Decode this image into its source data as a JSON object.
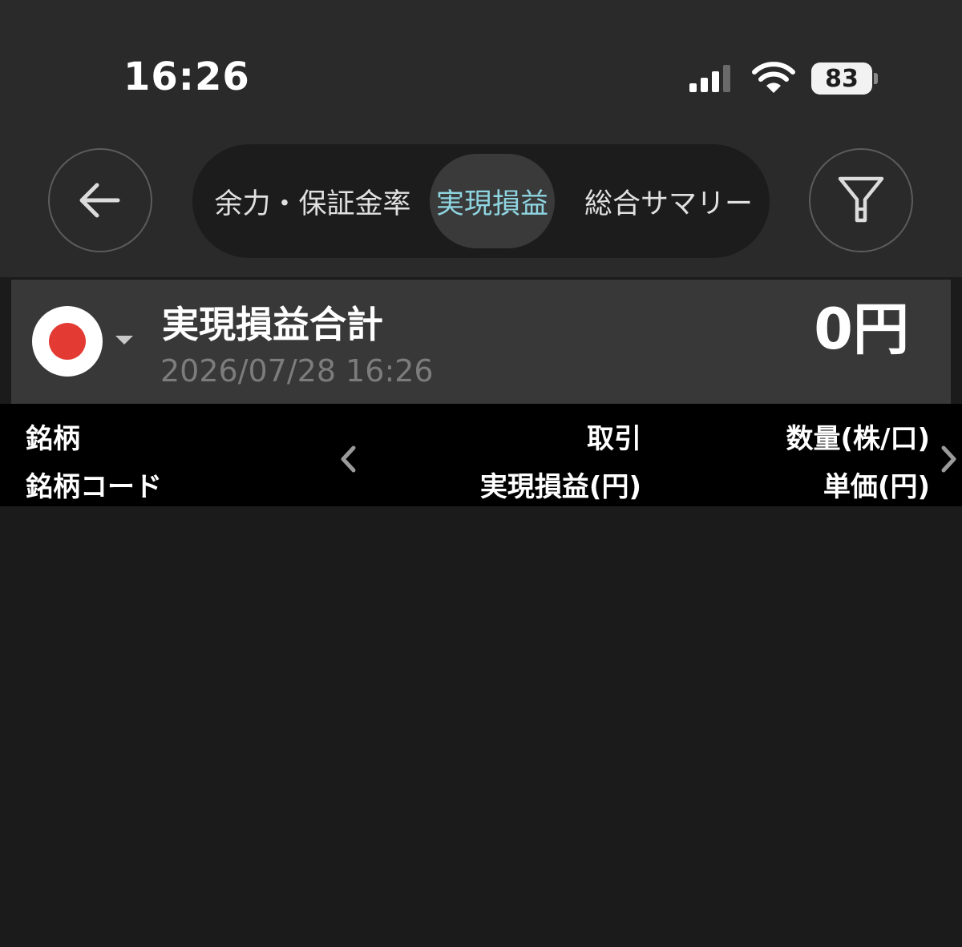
{
  "status_bar": {
    "time": "16:26",
    "battery": "83"
  },
  "nav": {
    "back_icon": "arrow-left-icon",
    "filter_icon": "filter-icon",
    "tabs": [
      {
        "label": "余力・保証金率",
        "active": false
      },
      {
        "label": "実現損益",
        "active": true
      },
      {
        "label": "総合サマリー",
        "active": false
      }
    ],
    "active_color": "#8fd5e1"
  },
  "summary": {
    "flag_icon": "japan-flag-icon",
    "title": "実現損益合計",
    "datetime": "2026/07/28 16:26",
    "amount": "0円"
  },
  "table": {
    "columns_left": {
      "line1": "銘柄",
      "line2": "銘柄コード"
    },
    "columns_mid": {
      "line1": "取引",
      "line2": "実現損益(円)"
    },
    "columns_right": {
      "line1": "数量(株/口)",
      "line2": "単価(円)"
    },
    "prev_icon": "chevron-left-icon",
    "next_icon": "chevron-right-icon",
    "rows": []
  }
}
